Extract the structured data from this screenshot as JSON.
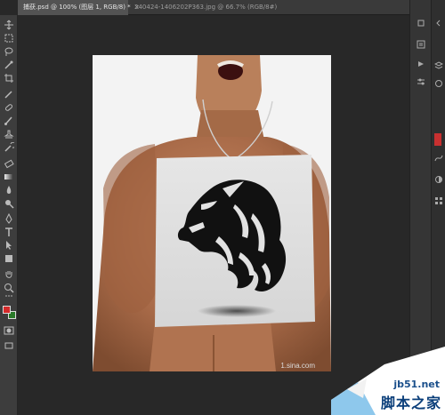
{
  "tabs": [
    {
      "label": "捕获.psd @ 100% (图层 1, RGB/8) *",
      "active": true,
      "close": "×"
    },
    {
      "label": "240424-1406202P363.jpg @ 66.7% (RGB/8#)",
      "active": false
    }
  ],
  "tools": [
    "move-tool-icon",
    "marquee-tool-icon",
    "lasso-tool-icon",
    "quick-select-icon",
    "crop-tool-icon",
    "eyedropper-icon",
    "healing-brush-icon",
    "brush-tool-icon",
    "clone-stamp-icon",
    "history-brush-icon",
    "eraser-icon",
    "gradient-tool-icon",
    "blur-tool-icon",
    "dodge-tool-icon",
    "pen-tool-icon",
    "type-tool-icon",
    "path-select-icon",
    "shape-tool-icon",
    "hand-tool-icon",
    "zoom-tool-icon"
  ],
  "colors": {
    "foreground": "#d42a2a",
    "background": "#2a7a2a"
  },
  "canvas_caption": "1.sina.com",
  "watermark": {
    "site": "jb51.net",
    "cn": "脚本之家"
  }
}
